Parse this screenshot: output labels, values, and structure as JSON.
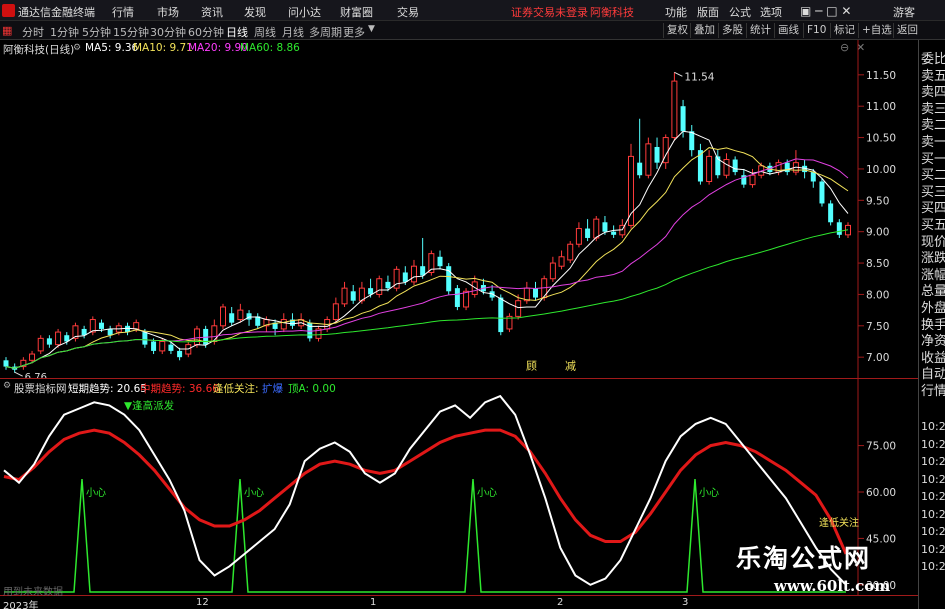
{
  "app": {
    "title": "通达信金融终端",
    "menus": [
      "行情",
      "市场",
      "资讯",
      "发现",
      "问小达",
      "财富圈",
      "交易"
    ],
    "notice": "证券交易未登录",
    "notice2": "阿衡科技",
    "right_menus": [
      "功能",
      "版面",
      "公式",
      "选项"
    ],
    "guest": "游客"
  },
  "toolbar": {
    "periods": [
      "分时",
      "1分钟",
      "5分钟",
      "15分钟",
      "30分钟",
      "60分钟",
      "日线",
      "周线",
      "月线",
      "多周期",
      "更多"
    ],
    "active_period": "日线",
    "buttons": [
      "复权",
      "叠加",
      "多股",
      "统计",
      "画线",
      "F10",
      "标记",
      "+自选",
      "返回"
    ]
  },
  "main_info": {
    "stock": "阿衡科技(日线)",
    "ma5": "MA5: 9.36",
    "ma10": "MA10: 9.71",
    "ma20": "MA20: 9.90",
    "ma60": "MA60: 8.86"
  },
  "side_panel": {
    "items": [
      "委比",
      "卖五",
      "卖四",
      "卖三",
      "卖二",
      "卖一",
      "买一",
      "买二",
      "买三",
      "买四",
      "买五",
      "现价",
      "涨跌",
      "涨幅",
      "总量",
      "外盘",
      "换手",
      "净资",
      "收益",
      "自动",
      "行情"
    ],
    "times": [
      "10:27",
      "10:27",
      "10:27",
      "10:27",
      "10:27",
      "10:27",
      "10:27",
      "10:27",
      "10:27"
    ]
  },
  "indicator_info": {
    "name": "股票指标网",
    "short": "短期趋势: 20.65",
    "mid": "中期趋势: 36.66",
    "low_focus": "逢低关注:",
    "bull_label": "扩爆",
    "top": "顶A: 0.00"
  },
  "footer": {
    "label": "用到未来数据",
    "year": "2023年",
    "months": [
      "12",
      "1",
      "2",
      "3"
    ]
  },
  "watermark": {
    "title": "乐淘公式网",
    "url": "www.60lt.com"
  },
  "chart_data": [
    {
      "type": "candlestick",
      "title": "阿衡科技(日线)",
      "y_ticks": [
        7.0,
        7.5,
        8.0,
        8.5,
        9.0,
        9.5,
        10.0,
        10.5,
        11.0,
        11.5
      ],
      "ylim": [
        6.7,
        11.8
      ],
      "annotations": [
        {
          "text": "11.54",
          "value": 11.54
        },
        {
          "text": "6.76",
          "value": 6.76
        },
        {
          "text": "顾",
          "value": 6.95
        },
        {
          "text": "减",
          "value": 6.95
        }
      ],
      "candles": [
        [
          6.95,
          6.85,
          7.0,
          6.8
        ],
        [
          6.85,
          6.8,
          6.9,
          6.75
        ],
        [
          6.85,
          6.95,
          7.0,
          6.8
        ],
        [
          6.95,
          7.05,
          7.1,
          6.9
        ],
        [
          7.1,
          7.3,
          7.35,
          7.05
        ],
        [
          7.3,
          7.2,
          7.35,
          7.15
        ],
        [
          7.2,
          7.4,
          7.45,
          7.15
        ],
        [
          7.35,
          7.25,
          7.4,
          7.2
        ],
        [
          7.3,
          7.5,
          7.55,
          7.25
        ],
        [
          7.45,
          7.35,
          7.5,
          7.3
        ],
        [
          7.4,
          7.6,
          7.65,
          7.35
        ],
        [
          7.55,
          7.45,
          7.6,
          7.4
        ],
        [
          7.45,
          7.35,
          7.5,
          7.3
        ],
        [
          7.4,
          7.5,
          7.55,
          7.35
        ],
        [
          7.5,
          7.4,
          7.55,
          7.35
        ],
        [
          7.45,
          7.55,
          7.6,
          7.4
        ],
        [
          7.4,
          7.2,
          7.45,
          7.15
        ],
        [
          7.25,
          7.1,
          7.3,
          7.05
        ],
        [
          7.1,
          7.25,
          7.3,
          7.05
        ],
        [
          7.2,
          7.1,
          7.25,
          7.05
        ],
        [
          7.1,
          7.0,
          7.15,
          6.95
        ],
        [
          7.05,
          7.2,
          7.25,
          7.0
        ],
        [
          7.2,
          7.45,
          7.5,
          7.15
        ],
        [
          7.45,
          7.2,
          7.5,
          7.15
        ],
        [
          7.25,
          7.5,
          7.6,
          7.2
        ],
        [
          7.5,
          7.8,
          7.85,
          7.45
        ],
        [
          7.7,
          7.55,
          7.8,
          7.5
        ],
        [
          7.6,
          7.75,
          7.85,
          7.55
        ],
        [
          7.7,
          7.6,
          7.75,
          7.5
        ],
        [
          7.65,
          7.5,
          7.7,
          7.45
        ],
        [
          7.5,
          7.6,
          7.65,
          7.4
        ],
        [
          7.55,
          7.45,
          7.6,
          7.35
        ],
        [
          7.45,
          7.6,
          7.7,
          7.4
        ],
        [
          7.6,
          7.5,
          7.7,
          7.45
        ],
        [
          7.5,
          7.6,
          7.7,
          7.45
        ],
        [
          7.55,
          7.3,
          7.6,
          7.25
        ],
        [
          7.3,
          7.45,
          7.5,
          7.25
        ],
        [
          7.45,
          7.6,
          7.65,
          7.4
        ],
        [
          7.6,
          7.85,
          7.95,
          7.55
        ],
        [
          7.85,
          8.1,
          8.2,
          7.8
        ],
        [
          8.05,
          7.9,
          8.15,
          7.85
        ],
        [
          7.9,
          8.1,
          8.2,
          7.85
        ],
        [
          8.1,
          8.0,
          8.25,
          7.95
        ],
        [
          8.0,
          8.25,
          8.3,
          7.95
        ],
        [
          8.2,
          8.1,
          8.3,
          8.05
        ],
        [
          8.1,
          8.4,
          8.45,
          8.05
        ],
        [
          8.35,
          8.2,
          8.45,
          8.15
        ],
        [
          8.2,
          8.45,
          8.55,
          8.15
        ],
        [
          8.45,
          8.3,
          8.9,
          8.25
        ],
        [
          8.35,
          8.65,
          8.7,
          8.3
        ],
        [
          8.6,
          8.45,
          8.7,
          8.4
        ],
        [
          8.45,
          8.05,
          8.5,
          8.0
        ],
        [
          8.1,
          7.8,
          8.15,
          7.75
        ],
        [
          7.8,
          8.05,
          8.1,
          7.75
        ],
        [
          8.0,
          8.2,
          8.3,
          7.95
        ],
        [
          8.15,
          8.05,
          8.25,
          8.0
        ],
        [
          8.05,
          7.95,
          8.15,
          7.9
        ],
        [
          7.95,
          7.4,
          8.0,
          7.35
        ],
        [
          7.45,
          7.65,
          7.7,
          7.4
        ],
        [
          7.65,
          7.9,
          8.0,
          7.6
        ],
        [
          7.9,
          8.1,
          8.2,
          7.85
        ],
        [
          8.1,
          7.95,
          8.2,
          7.9
        ],
        [
          7.95,
          8.25,
          8.3,
          7.9
        ],
        [
          8.25,
          8.5,
          8.6,
          8.2
        ],
        [
          8.45,
          8.6,
          8.7,
          8.4
        ],
        [
          8.55,
          8.8,
          8.85,
          8.5
        ],
        [
          8.8,
          9.05,
          9.15,
          8.75
        ],
        [
          9.05,
          8.9,
          9.2,
          8.85
        ],
        [
          8.9,
          9.2,
          9.25,
          8.85
        ],
        [
          9.15,
          9.0,
          9.25,
          8.95
        ],
        [
          9.0,
          8.95,
          9.1,
          8.9
        ],
        [
          8.95,
          9.1,
          9.2,
          8.9
        ],
        [
          9.1,
          10.2,
          10.4,
          9.05
        ],
        [
          10.1,
          9.9,
          10.8,
          9.85
        ],
        [
          9.9,
          10.4,
          10.5,
          9.85
        ],
        [
          10.35,
          10.1,
          10.5,
          10.0
        ],
        [
          10.1,
          10.5,
          10.55,
          10.0
        ],
        [
          10.5,
          11.4,
          11.54,
          10.45
        ],
        [
          11.0,
          10.6,
          11.1,
          10.5
        ],
        [
          10.6,
          10.3,
          10.7,
          10.2
        ],
        [
          10.3,
          9.8,
          10.4,
          9.75
        ],
        [
          9.8,
          10.2,
          10.3,
          9.75
        ],
        [
          10.2,
          9.9,
          10.3,
          9.85
        ],
        [
          9.9,
          10.15,
          10.25,
          9.85
        ],
        [
          10.15,
          9.95,
          10.2,
          9.9
        ],
        [
          9.9,
          9.75,
          10.0,
          9.7
        ],
        [
          9.75,
          9.9,
          10.0,
          9.7
        ],
        [
          9.9,
          10.05,
          10.1,
          9.85
        ],
        [
          10.05,
          9.95,
          10.1,
          9.9
        ],
        [
          9.95,
          10.1,
          10.15,
          9.9
        ],
        [
          10.1,
          9.95,
          10.15,
          9.9
        ],
        [
          9.95,
          10.1,
          10.3,
          9.9
        ],
        [
          10.05,
          9.95,
          10.15,
          9.85
        ],
        [
          9.95,
          9.8,
          10.0,
          9.7
        ],
        [
          9.8,
          9.45,
          9.85,
          9.4
        ],
        [
          9.45,
          9.15,
          9.5,
          9.1
        ],
        [
          9.15,
          8.95,
          9.2,
          8.9
        ],
        [
          8.95,
          9.1,
          9.15,
          8.9
        ]
      ]
    },
    {
      "type": "line",
      "title": "股票指标网",
      "y_ticks": [
        30.0,
        45.0,
        60.0,
        75.0
      ],
      "ylim": [
        28,
        92
      ],
      "annotations": [
        {
          "text": "▼逢高派发"
        },
        {
          "text": "小心"
        },
        {
          "text": "小心"
        },
        {
          "text": "小心"
        },
        {
          "text": "小心"
        },
        {
          "text": "逢低关注"
        }
      ],
      "series": [
        {
          "values": [
            67,
            63,
            69,
            78,
            85,
            87,
            89,
            88,
            85,
            80,
            72,
            64,
            54,
            38,
            33,
            36,
            40,
            44,
            48,
            56,
            70,
            74,
            76,
            73,
            66,
            63,
            66,
            74,
            80,
            86,
            88,
            84,
            89,
            91,
            85,
            72,
            58,
            42,
            33,
            30,
            32,
            38,
            48,
            58,
            70,
            78,
            82,
            84,
            82,
            76,
            70,
            64,
            58,
            50,
            42,
            35,
            30
          ]
        },
        {
          "values": [
            65,
            64,
            68,
            73,
            77,
            79,
            80,
            79,
            76,
            72,
            67,
            61,
            55,
            51,
            49,
            49,
            51,
            54,
            58,
            62,
            66,
            69,
            70,
            69,
            67,
            66,
            67,
            70,
            73,
            76,
            78,
            79,
            80,
            80,
            78,
            73,
            66,
            58,
            51,
            46,
            44,
            44,
            47,
            53,
            60,
            67,
            72,
            75,
            76,
            75,
            73,
            70,
            67,
            63,
            59,
            51,
            40
          ]
        },
        {
          "values": [
            0,
            0,
            0,
            0,
            0,
            0,
            0,
            0,
            0,
            0,
            0,
            0,
            0,
            0,
            0,
            0,
            0,
            0,
            0,
            0,
            0,
            0,
            0,
            0,
            0,
            0,
            0,
            0,
            0,
            0,
            0,
            0,
            0,
            0,
            0,
            0,
            0,
            0,
            0,
            0,
            0,
            0,
            0,
            0,
            0,
            0,
            0,
            0,
            0,
            0,
            0,
            0,
            0,
            0,
            0,
            0,
            0
          ]
        }
      ]
    }
  ]
}
